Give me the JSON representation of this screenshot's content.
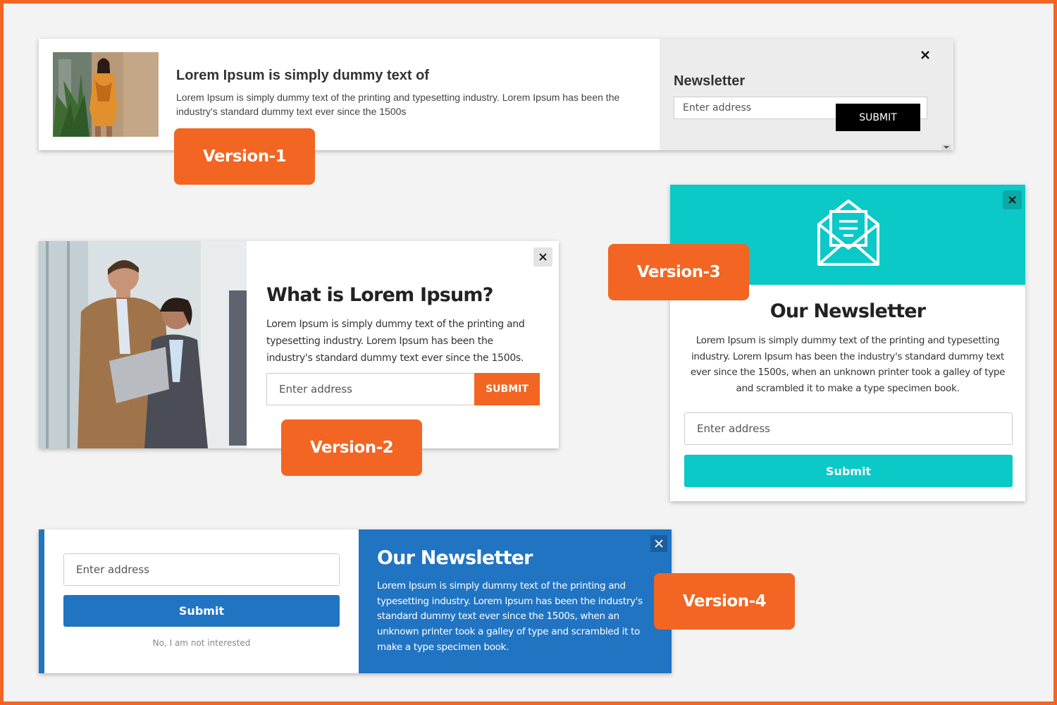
{
  "v1": {
    "title": "Lorem Ipsum is simply dummy text of",
    "body": "Lorem Ipsum is simply dummy text of the printing and typesetting industry. Lorem Ipsum has been the industry's standard dummy text ever since the 1500s",
    "newsletter_heading": "Newsletter",
    "input_placeholder": "Enter address",
    "submit_label": "SUBMIT",
    "badge": "Version-1"
  },
  "v2": {
    "title": "What is Lorem Ipsum?",
    "body": "Lorem Ipsum is simply dummy text of the printing and typesetting industry. Lorem Ipsum has been the industry's standard dummy text ever since the 1500s.",
    "input_placeholder": "Enter address",
    "submit_label": "SUBMIT",
    "badge": "Version-2"
  },
  "v3": {
    "title": "Our Newsletter",
    "body": "Lorem Ipsum is simply dummy text of the printing and typesetting industry. Lorem Ipsum has been the industry's standard dummy text ever since the 1500s, when an unknown printer took a galley of type and scrambled it to make a type specimen book.",
    "input_placeholder": "Enter address",
    "submit_label": "Submit",
    "badge": "Version-3"
  },
  "v4": {
    "title": "Our Newsletter",
    "body": "Lorem Ipsum is simply dummy text of the printing and typesetting industry. Lorem Ipsum has been the industry's standard dummy text ever since the 1500s, when an unknown printer took a galley of type and scrambled it to make a type specimen book.",
    "input_placeholder": "Enter address",
    "submit_label": "Submit",
    "decline_link": "No, I am not interested",
    "badge": "Version-4"
  },
  "colors": {
    "accent_orange": "#f26522",
    "teal": "#0bc9c7",
    "blue": "#2174c2",
    "black_button": "#000000",
    "grey_panel": "#ececec"
  },
  "icons": {
    "close": "close-icon",
    "envelope": "open-envelope-icon",
    "woman_photo": "woman-photo",
    "business_photo": "business-people-photo"
  }
}
